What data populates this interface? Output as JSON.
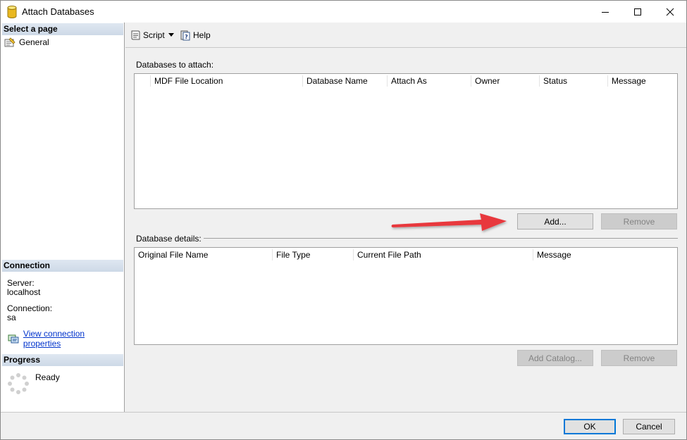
{
  "window": {
    "title": "Attach Databases"
  },
  "left_panel": {
    "select_page_header": "Select a page",
    "pages": [
      {
        "label": "General",
        "icon": "general-page-icon"
      }
    ],
    "connection_header": "Connection",
    "server_label": "Server:",
    "server_value": "localhost",
    "connection_label": "Connection:",
    "connection_value": "sa",
    "view_connection_link": "View connection properties",
    "progress_header": "Progress",
    "progress_status": "Ready"
  },
  "toolbar": {
    "script_label": "Script",
    "help_label": "Help"
  },
  "attach_section": {
    "label": "Databases to attach:",
    "columns": [
      "MDF File Location",
      "Database Name",
      "Attach As",
      "Owner",
      "Status",
      "Message"
    ],
    "rows": [],
    "add_button": "Add...",
    "remove_button": "Remove"
  },
  "details_section": {
    "label": "Database details:",
    "columns": [
      "Original File Name",
      "File Type",
      "Current File Path",
      "Message"
    ],
    "rows": [],
    "add_catalog_button": "Add Catalog...",
    "remove_button": "Remove"
  },
  "footer": {
    "ok_button": "OK",
    "cancel_button": "Cancel"
  },
  "colors": {
    "accent": "#0078d7",
    "link": "#0033cc",
    "arrow": "#e8383d"
  }
}
